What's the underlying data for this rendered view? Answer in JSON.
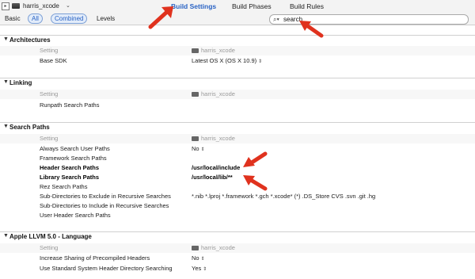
{
  "toolbar": {
    "target_name": "harris_xcode",
    "tabs": [
      "Build Settings",
      "Build Phases",
      "Build Rules"
    ]
  },
  "filters": {
    "basic": "Basic",
    "all": "All",
    "combined": "Combined",
    "levels": "Levels",
    "search_value": "search"
  },
  "sections": [
    {
      "title": "Architectures",
      "column_header": "Setting",
      "target_header": "harris_xcode",
      "rows": [
        {
          "setting": "Base SDK",
          "value": "Latest OS X (OS X 10.9)"
        }
      ]
    },
    {
      "title": "Linking",
      "column_header": "Setting",
      "target_header": "harris_xcode",
      "rows": [
        {
          "setting": "Runpath Search Paths",
          "value": ""
        }
      ]
    },
    {
      "title": "Search Paths",
      "column_header": "Setting",
      "target_header": "harris_xcode",
      "rows": [
        {
          "setting": "Always Search User Paths",
          "value": "No"
        },
        {
          "setting": "Framework Search Paths",
          "value": ""
        },
        {
          "setting": "Header Search Paths",
          "value": "/usr/local/include"
        },
        {
          "setting": "Library Search Paths",
          "value": "/usr/local/lib/**"
        },
        {
          "setting": "Rez Search Paths",
          "value": ""
        },
        {
          "setting": "Sub-Directories to Exclude in Recursive Searches",
          "value": "*.nib *.lproj *.framework *.gch *.xcode* (*) .DS_Store CVS .svn .git .hg"
        },
        {
          "setting": "Sub-Directories to Include in Recursive Searches",
          "value": ""
        },
        {
          "setting": "User Header Search Paths",
          "value": ""
        }
      ]
    },
    {
      "title": "Apple LLVM 5.0 - Language",
      "column_header": "Setting",
      "target_header": "harris_xcode",
      "rows": [
        {
          "setting": "Increase Sharing of Precompiled Headers",
          "value": "No"
        },
        {
          "setting": "Use Standard System Header Directory Searching",
          "value": "Yes"
        }
      ]
    }
  ],
  "icons": {
    "disclosure": "disclosure-triangle-icon",
    "search": "search-icon",
    "target": "target-icon",
    "annotation": "red-arrow-annotation"
  },
  "colors": {
    "accent": "#2a63c4",
    "annotation": "#e0321e"
  }
}
